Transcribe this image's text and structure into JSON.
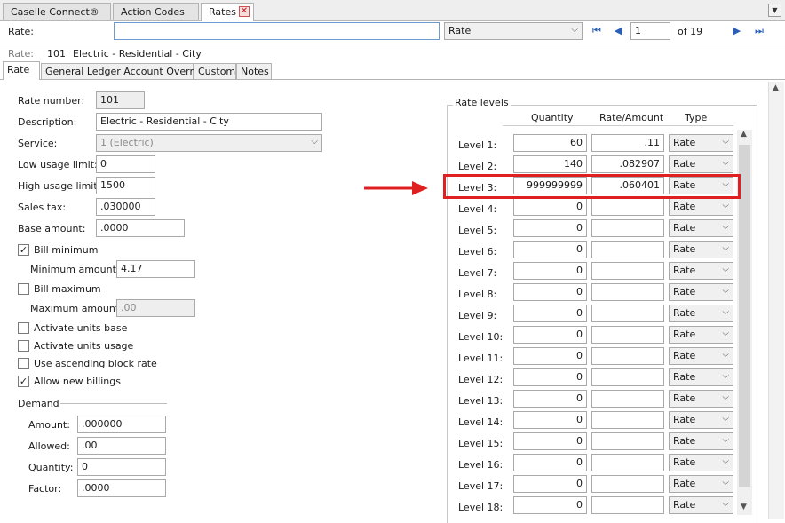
{
  "doc_tabs": [
    "Caselle Connect®",
    "Action Codes",
    "Rates"
  ],
  "toolbar": {
    "rate_label": "Rate:",
    "search_value": "",
    "search_type": "Rate",
    "record_position": "1",
    "record_total": "of 19"
  },
  "record_info": {
    "label": "Rate:",
    "number": "101",
    "description": "Electric - Residential - City"
  },
  "inner_tabs": [
    "Rate",
    "General Ledger Account Override",
    "Custom",
    "Notes"
  ],
  "form": {
    "rate_number": {
      "label": "Rate number:",
      "value": "101"
    },
    "description": {
      "label": "Description:",
      "value": "Electric - Residential - City"
    },
    "service": {
      "label": "Service:",
      "value": "1 (Electric)"
    },
    "low_usage_limit": {
      "label": "Low usage limit:",
      "value": "0"
    },
    "high_usage_limit": {
      "label": "High usage limit:",
      "value": "1500"
    },
    "sales_tax": {
      "label": "Sales tax:",
      "value": ".030000"
    },
    "base_amount": {
      "label": "Base amount:",
      "value": ".0000"
    },
    "bill_minimum": {
      "label": "Bill minimum",
      "checked": true
    },
    "minimum_amount": {
      "label": "Minimum amount:",
      "value": "4.17"
    },
    "bill_maximum": {
      "label": "Bill maximum",
      "checked": false
    },
    "maximum_amount": {
      "label": "Maximum amount:",
      "value": ".00"
    },
    "activate_units_base": {
      "label": "Activate units base",
      "checked": false
    },
    "activate_units_usage": {
      "label": "Activate units usage",
      "checked": false
    },
    "use_ascending_block_rate": {
      "label": "Use ascending block rate",
      "checked": false
    },
    "allow_new_billings": {
      "label": "Allow new billings",
      "checked": true
    }
  },
  "demand": {
    "title": "Demand",
    "amount": {
      "label": "Amount:",
      "value": ".000000"
    },
    "allowed": {
      "label": "Allowed:",
      "value": ".00"
    },
    "quantity": {
      "label": "Quantity:",
      "value": "0"
    },
    "factor": {
      "label": "Factor:",
      "value": ".0000"
    }
  },
  "rate_levels": {
    "title": "Rate levels",
    "columns": [
      "Quantity",
      "Rate/Amount",
      "Type"
    ],
    "rows": [
      {
        "label": "Level 1:",
        "quantity": "60",
        "rate": ".11",
        "type": "Rate"
      },
      {
        "label": "Level 2:",
        "quantity": "140",
        "rate": ".082907",
        "type": "Rate"
      },
      {
        "label": "Level 3:",
        "quantity": "999999999",
        "rate": ".060401",
        "type": "Rate"
      },
      {
        "label": "Level 4:",
        "quantity": "0",
        "rate": "",
        "type": "Rate"
      },
      {
        "label": "Level 5:",
        "quantity": "0",
        "rate": "",
        "type": "Rate"
      },
      {
        "label": "Level 6:",
        "quantity": "0",
        "rate": "",
        "type": "Rate"
      },
      {
        "label": "Level 7:",
        "quantity": "0",
        "rate": "",
        "type": "Rate"
      },
      {
        "label": "Level 8:",
        "quantity": "0",
        "rate": "",
        "type": "Rate"
      },
      {
        "label": "Level 9:",
        "quantity": "0",
        "rate": "",
        "type": "Rate"
      },
      {
        "label": "Level 10:",
        "quantity": "0",
        "rate": "",
        "type": "Rate"
      },
      {
        "label": "Level 11:",
        "quantity": "0",
        "rate": "",
        "type": "Rate"
      },
      {
        "label": "Level 12:",
        "quantity": "0",
        "rate": "",
        "type": "Rate"
      },
      {
        "label": "Level 13:",
        "quantity": "0",
        "rate": "",
        "type": "Rate"
      },
      {
        "label": "Level 14:",
        "quantity": "0",
        "rate": "",
        "type": "Rate"
      },
      {
        "label": "Level 15:",
        "quantity": "0",
        "rate": "",
        "type": "Rate"
      },
      {
        "label": "Level 16:",
        "quantity": "0",
        "rate": "",
        "type": "Rate"
      },
      {
        "label": "Level 17:",
        "quantity": "0",
        "rate": "",
        "type": "Rate"
      },
      {
        "label": "Level 18:",
        "quantity": "0",
        "rate": "",
        "type": "Rate"
      }
    ]
  },
  "icons": {
    "close": "close-icon",
    "dropdown": "chevron-down-icon",
    "first": "first-record-icon",
    "prev": "previous-record-icon",
    "next": "next-record-icon",
    "last": "last-record-icon",
    "check": "check-icon",
    "annotation": "red-arrow-icon"
  },
  "colors": {
    "highlight": "#e02020",
    "nav_arrows": "#2a5fb8"
  }
}
